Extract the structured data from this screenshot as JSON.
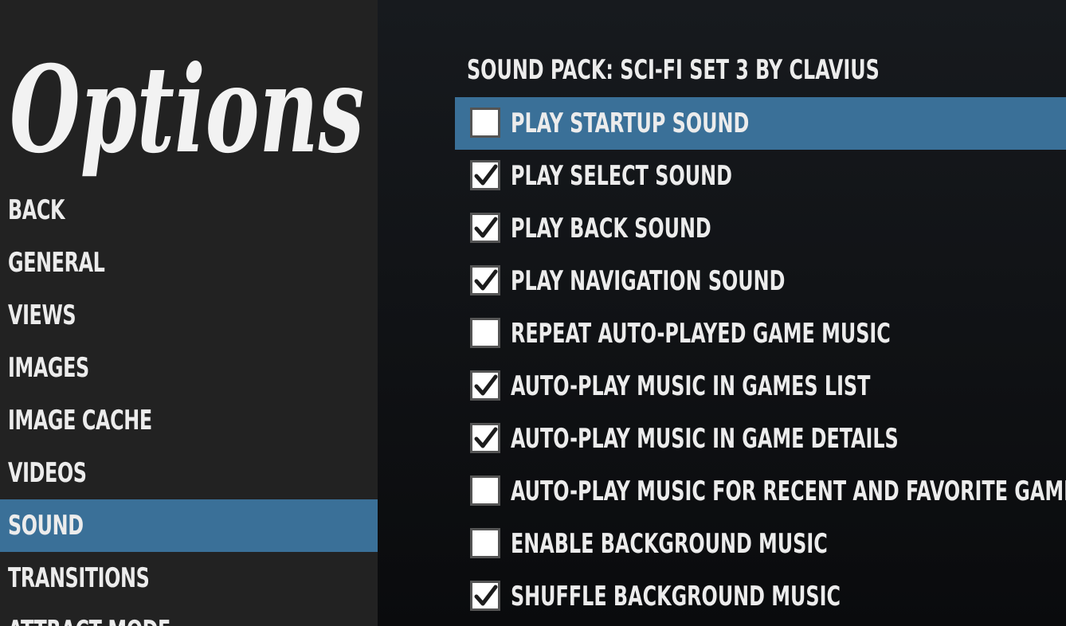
{
  "logo_text": "Options",
  "sidebar": {
    "items": [
      {
        "label": "BACK",
        "selected": false
      },
      {
        "label": "GENERAL",
        "selected": false
      },
      {
        "label": "VIEWS",
        "selected": false
      },
      {
        "label": "IMAGES",
        "selected": false
      },
      {
        "label": "IMAGE CACHE",
        "selected": false
      },
      {
        "label": "VIDEOS",
        "selected": false
      },
      {
        "label": "SOUND",
        "selected": true
      },
      {
        "label": "TRANSITIONS",
        "selected": false
      },
      {
        "label": "ATTRACT MODE",
        "selected": false
      }
    ]
  },
  "main": {
    "sound_pack": "SOUND PACK: SCI-FI SET 3 BY CLAVIUS",
    "options": [
      {
        "label": "PLAY STARTUP SOUND",
        "checked": false,
        "selected": true
      },
      {
        "label": "PLAY SELECT SOUND",
        "checked": true,
        "selected": false
      },
      {
        "label": "PLAY BACK SOUND",
        "checked": true,
        "selected": false
      },
      {
        "label": "PLAY NAVIGATION SOUND",
        "checked": true,
        "selected": false
      },
      {
        "label": "REPEAT AUTO-PLAYED GAME MUSIC",
        "checked": false,
        "selected": false
      },
      {
        "label": "AUTO-PLAY MUSIC IN GAMES LIST",
        "checked": true,
        "selected": false
      },
      {
        "label": "AUTO-PLAY MUSIC IN GAME DETAILS",
        "checked": true,
        "selected": false
      },
      {
        "label": "AUTO-PLAY MUSIC FOR RECENT AND FAVORITE GAMES",
        "checked": false,
        "selected": false
      },
      {
        "label": "ENABLE BACKGROUND MUSIC",
        "checked": false,
        "selected": false
      },
      {
        "label": "SHUFFLE BACKGROUND MUSIC",
        "checked": true,
        "selected": false
      }
    ]
  },
  "colors": {
    "sidebar_bg": "#222222",
    "selection": "#3a7098",
    "text": "#ececec",
    "main_bg": "#0c0e11"
  }
}
